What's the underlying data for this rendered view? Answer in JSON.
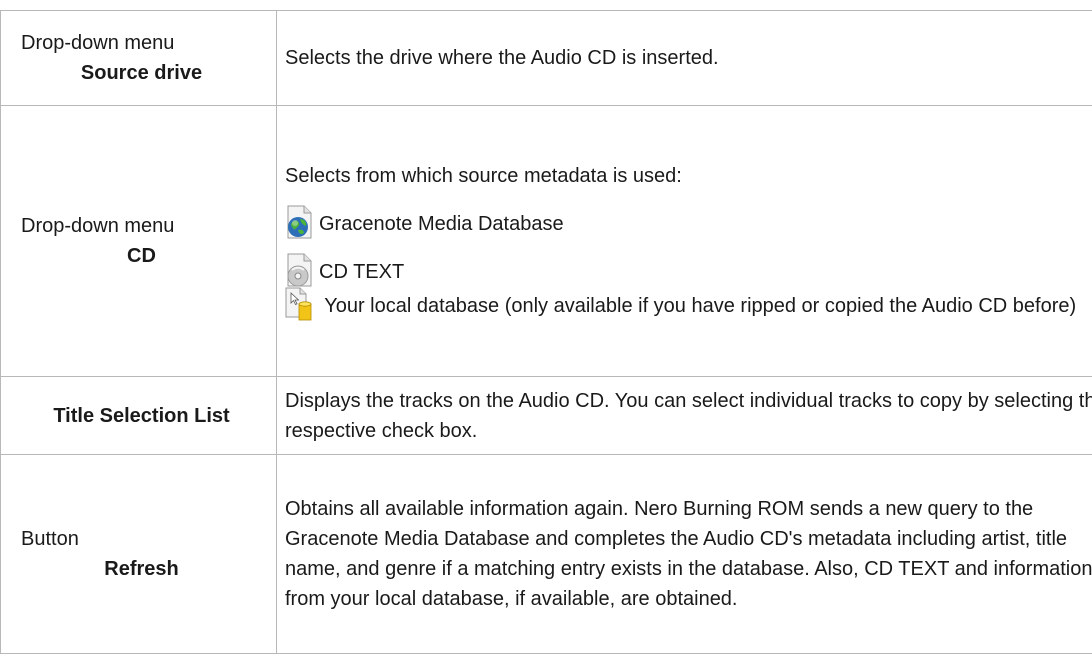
{
  "rows": [
    {
      "kind": "Drop-down menu",
      "name": "Source drive",
      "description": "Selects the drive where the Audio CD is inserted."
    },
    {
      "kind": "Drop-down menu",
      "name": "CD",
      "description_intro": "Selects from which source metadata is used:",
      "options": [
        {
          "icon": "gracenote-globe-icon",
          "label": "Gracenote Media Database"
        },
        {
          "icon": "cd-text-icon",
          "label": "CD TEXT"
        },
        {
          "icon": "local-database-icon",
          "label": "Your local database (only available if you have ripped or copied the Audio CD before)"
        }
      ]
    },
    {
      "kind": "",
      "name": "Title Selection List",
      "description": "Displays the tracks on the Audio CD. You can select individual tracks to copy by selecting the respective check box."
    },
    {
      "kind": "Button",
      "name": "Refresh",
      "description": "Obtains all available information again. Nero Burning ROM sends a new query to the Gracenote Media Database and completes the Audio CD's metadata including artist, title name, and genre if a matching entry exists in the database. Also, CD TEXT and information from your local database, if available, are obtained."
    }
  ]
}
